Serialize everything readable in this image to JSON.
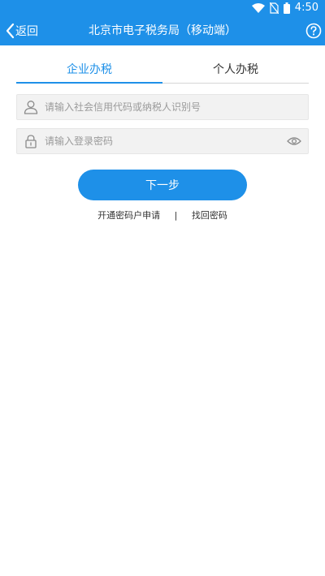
{
  "status_bar": {
    "time": "4:50",
    "icons": [
      "wifi-icon",
      "no-sim-icon",
      "battery-icon"
    ]
  },
  "header": {
    "back_label": "返回",
    "title": "北京市电子税务局（移动端）",
    "back_icon": "chevron-left-icon",
    "help_icon": "help-icon"
  },
  "tabs": [
    {
      "label": "企业办税",
      "active": true
    },
    {
      "label": "个人办税",
      "active": false
    }
  ],
  "form": {
    "username": {
      "icon": "user-icon",
      "placeholder": "请输入社会信用代码或纳税人识别号",
      "value": ""
    },
    "password": {
      "icon": "lock-icon",
      "placeholder": "请输入登录密码",
      "value": "",
      "toggle_icon": "eye-icon"
    },
    "next_label": "下一步"
  },
  "links": {
    "register": "开通密码户申请",
    "separator": "|",
    "recover": "找回密码"
  },
  "colors": {
    "primary": "#1e90e8",
    "field_bg": "#f2f2f2",
    "text": "#333333",
    "placeholder": "#9a9a9a"
  }
}
